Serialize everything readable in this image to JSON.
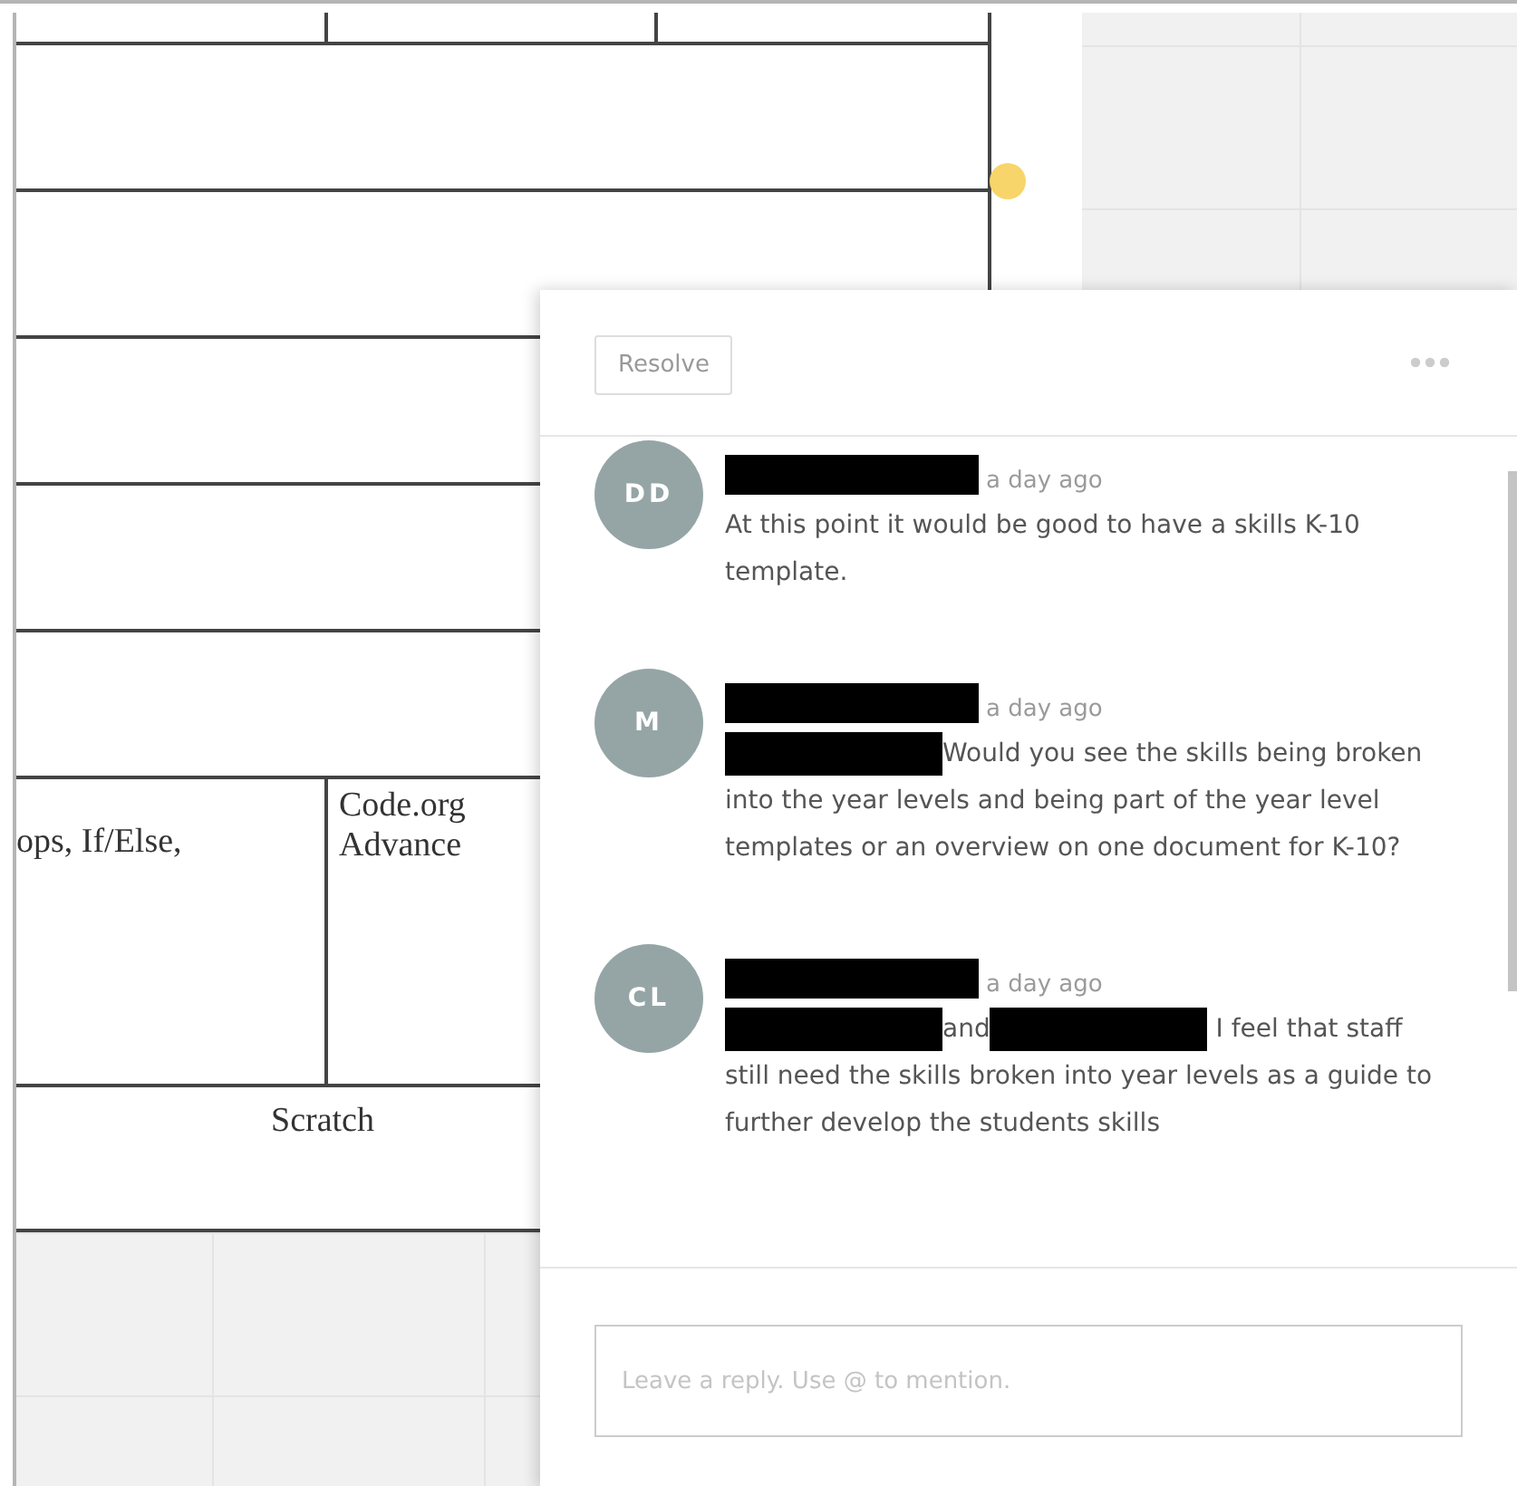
{
  "document": {
    "split_row": [
      {
        "lines": [
          "ops, If/Else,"
        ]
      },
      {
        "lines": [
          "Code.org",
          "Advance"
        ]
      }
    ],
    "full_row": {
      "text": "Scratch"
    }
  },
  "comment_panel": {
    "resolve_button": "Resolve",
    "comments": [
      {
        "initials": "DD",
        "author": {
          "kind": "redacted"
        },
        "time": "a day ago",
        "body": [
          {
            "kind": "text",
            "text": "At this point it would be good to have a skills K-10 template."
          }
        ]
      },
      {
        "initials": "M",
        "author": {
          "kind": "redacted"
        },
        "time": "a day ago",
        "body": [
          {
            "kind": "redacted"
          },
          {
            "kind": "text",
            "text": "Would you see the skills being broken into the year levels and being part of the year level templates or an overview on one document for K-10?"
          }
        ]
      },
      {
        "initials": "CL",
        "author": {
          "kind": "redacted"
        },
        "time": "a day ago",
        "body": [
          {
            "kind": "redacted"
          },
          {
            "kind": "text",
            "text": "and"
          },
          {
            "kind": "redacted"
          },
          {
            "kind": "text",
            "text": " I feel that staff still need the skills broken into year levels as a guide to further develop the students skills"
          }
        ]
      }
    ],
    "reply": {
      "placeholder": "Leave a reply. Use @ to mention."
    }
  }
}
